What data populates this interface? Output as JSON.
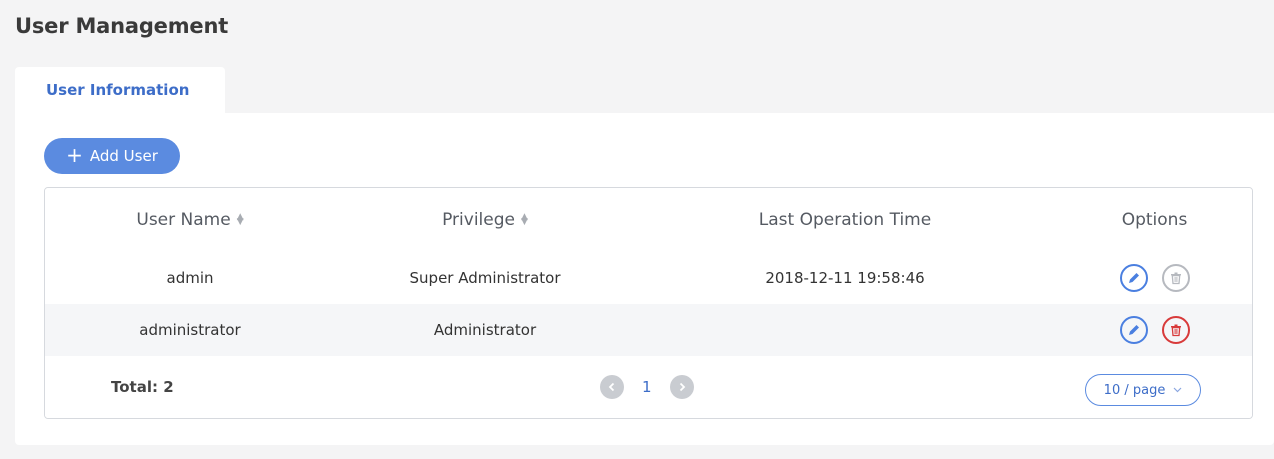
{
  "page": {
    "title": "User Management"
  },
  "tabs": [
    {
      "label": "User Information"
    }
  ],
  "toolbar": {
    "add_user_label": "Add User",
    "add_icon": "plus-icon"
  },
  "table": {
    "columns": [
      "User Name",
      "Privilege",
      "Last Operation Time",
      "Options"
    ],
    "sortable": [
      true,
      true,
      false,
      false
    ],
    "rows": [
      {
        "user_name": "admin",
        "privilege": "Super Administrator",
        "last_operation_time": "2018-12-11 19:58:46",
        "delete_enabled": false
      },
      {
        "user_name": "administrator",
        "privilege": "Administrator",
        "last_operation_time": "",
        "delete_enabled": true
      }
    ]
  },
  "pagination": {
    "total_label": "Total: 2",
    "current_page": "1",
    "page_size_label": "10 / page"
  },
  "colors": {
    "accent": "#5b8be0",
    "tab_text": "#3d6dc8",
    "delete_active": "#d83a3a",
    "delete_disabled": "#b6b9bf"
  }
}
